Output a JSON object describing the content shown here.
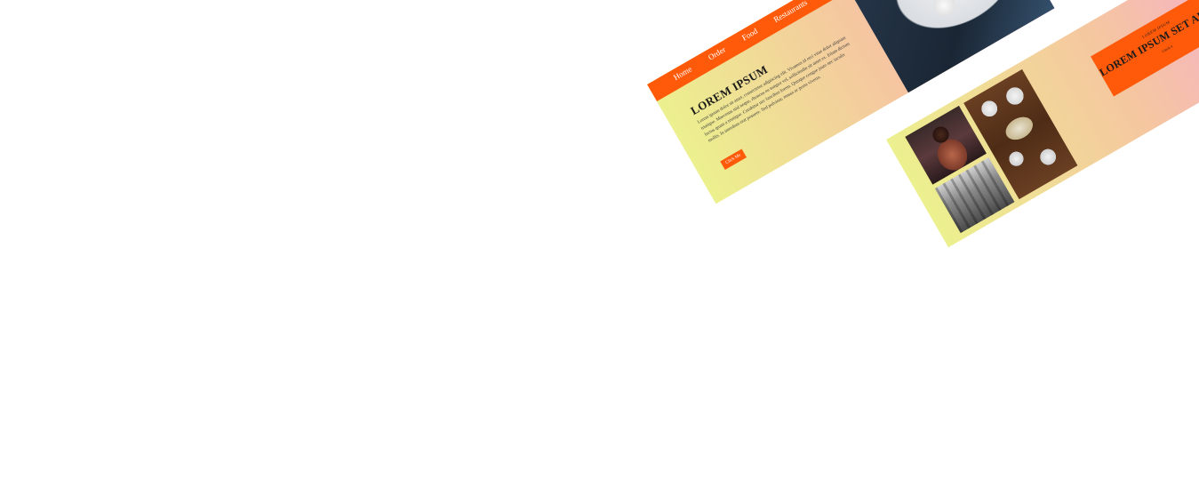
{
  "card_1": {
    "nav": [
      "Home",
      "Order",
      "Food",
      "Restaurants"
    ],
    "title": "LOREM IPSUM",
    "body": "Lorem ipsum dolor sit amet, consectetur adipiscing elit. Vivamus id orci vitae dolor aliquam tristique. Maecenas nisl neque, rhoncus eu tempor vel, sollicitudin sit amet ex. Etiam dictum luctus quam a tristique. Curabitur nec faucibus lorem. Quisque congue justo nec iaculis mollis. In interdum erat posuere. Sed pulvinar, massa ac porta viverra.",
    "button": "Click Me"
  },
  "card_2": {
    "banner_kicker": "LOREM IPSUM",
    "banner_title": "LOREM IPSUM SET ADEMIR",
    "banner_link": "Check it"
  },
  "colors": {
    "accent": "#ff5a0a",
    "gradient_start": "#ecf08e",
    "gradient_end": "#f6a8d6"
  }
}
